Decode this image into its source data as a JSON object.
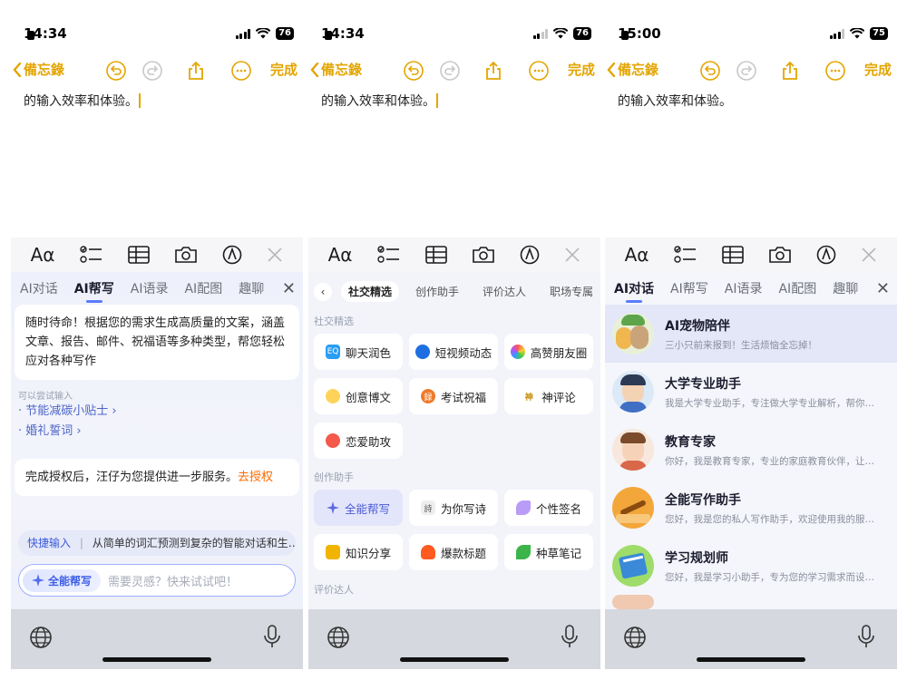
{
  "colors": {
    "accent_yellow": "#e3a500",
    "ai_blue": "#5b7cff",
    "orange_link": "#ff6a00"
  },
  "common": {
    "back_label": "備忘錄",
    "done_label": "完成",
    "note_text": "的输入效率和体验。",
    "toolbar": {
      "text_format": "Aα"
    },
    "tabs": [
      "AI对话",
      "AI帮写",
      "AI语录",
      "AI配图",
      "趣聊"
    ],
    "icons": [
      "undo-icon",
      "redo-icon",
      "share-icon",
      "more-icon",
      "checklist-icon",
      "table-icon",
      "camera-icon",
      "markup-icon",
      "close-icon",
      "globe-icon",
      "microphone-icon"
    ]
  },
  "phones": [
    {
      "time": "14:34",
      "battery": "76"
    },
    {
      "time": "14:34",
      "battery": "76"
    },
    {
      "time": "15:00",
      "battery": "75"
    }
  ],
  "screen1": {
    "active_tab": "AI帮写",
    "intro": "随时待命！根据您的需求生成高质量的文案，涵盖文章、报告、邮件、祝福语等多种类型，帮您轻松应对各种写作",
    "hint_title": "可以尝试输入",
    "hints": [
      "· 节能减碳小贴士 ›",
      "· 婚礼誓词 ›"
    ],
    "auth_text": "完成授权后，汪仔为您提供进一步服务。",
    "auth_link": "去授权",
    "quick_label": "快捷输入",
    "quick_text": "从简单的词汇预测到复杂的智能对话和生…",
    "pill_label": "全能帮写",
    "placeholder": "需要灵感？快来试试吧！"
  },
  "screen2": {
    "subtabs": [
      "社交精选",
      "创作助手",
      "评价达人",
      "职场专属"
    ],
    "sections": [
      "社交精选",
      "创作助手",
      "评价达人"
    ],
    "social_chips": [
      "聊天润色",
      "短视频动态",
      "高赞朋友圈",
      "创意博文",
      "考试祝福",
      "神评论",
      "恋爱助攻"
    ],
    "creative_chips": [
      "全能帮写",
      "为你写诗",
      "个性签名",
      "知识分享",
      "爆款标题",
      "种草笔记"
    ],
    "chip_icons": {
      "chat": "EQ",
      "exam": "録",
      "god": "神",
      "poem": "詩"
    }
  },
  "screen3": {
    "active_tab": "AI对话",
    "assistants": [
      {
        "name": "AI宠物陪伴",
        "desc": "三小只前来报到！生活烦恼全忘掉！"
      },
      {
        "name": "大学专业助手",
        "desc": "我是大学专业助手，专注做大学专业解析，帮你…"
      },
      {
        "name": "教育专家",
        "desc": "你好，我是教育专家，专业的家庭教育伙伴，让…"
      },
      {
        "name": "全能写作助手",
        "desc": "您好，我是您的私人写作助手，欢迎使用我的服…"
      },
      {
        "name": "学习规划师",
        "desc": "您好，我是学习小助手，专为您的学习需求而设…"
      }
    ]
  }
}
